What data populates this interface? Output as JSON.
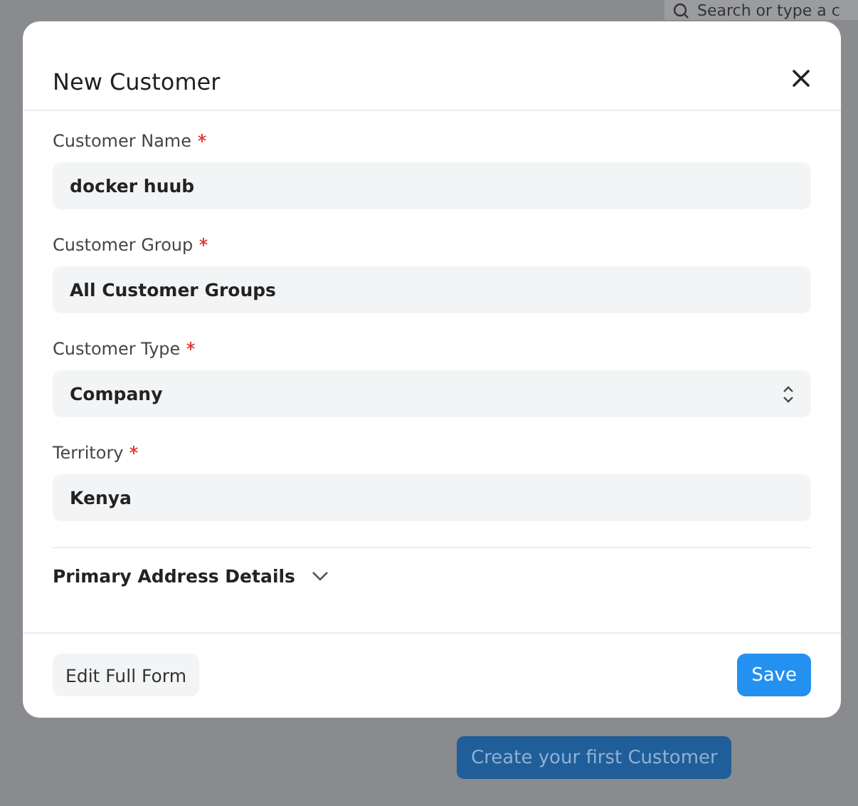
{
  "background": {
    "search": {
      "placeholder": "Search or type a c"
    },
    "create_button": "Create your first Customer"
  },
  "dialog": {
    "title": "New Customer",
    "fields": [
      {
        "label": "Customer Name",
        "required": true,
        "kind": "text",
        "value": "docker huub"
      },
      {
        "label": "Customer Group",
        "required": true,
        "kind": "text",
        "value": "All Customer Groups"
      },
      {
        "label": "Customer Type",
        "required": true,
        "kind": "select",
        "value": "Company"
      },
      {
        "label": "Territory",
        "required": true,
        "kind": "text",
        "value": "Kenya"
      }
    ],
    "section": {
      "label": "Primary Address Details",
      "expanded": false
    },
    "buttons": {
      "secondary": "Edit Full Form",
      "primary": "Save"
    }
  }
}
